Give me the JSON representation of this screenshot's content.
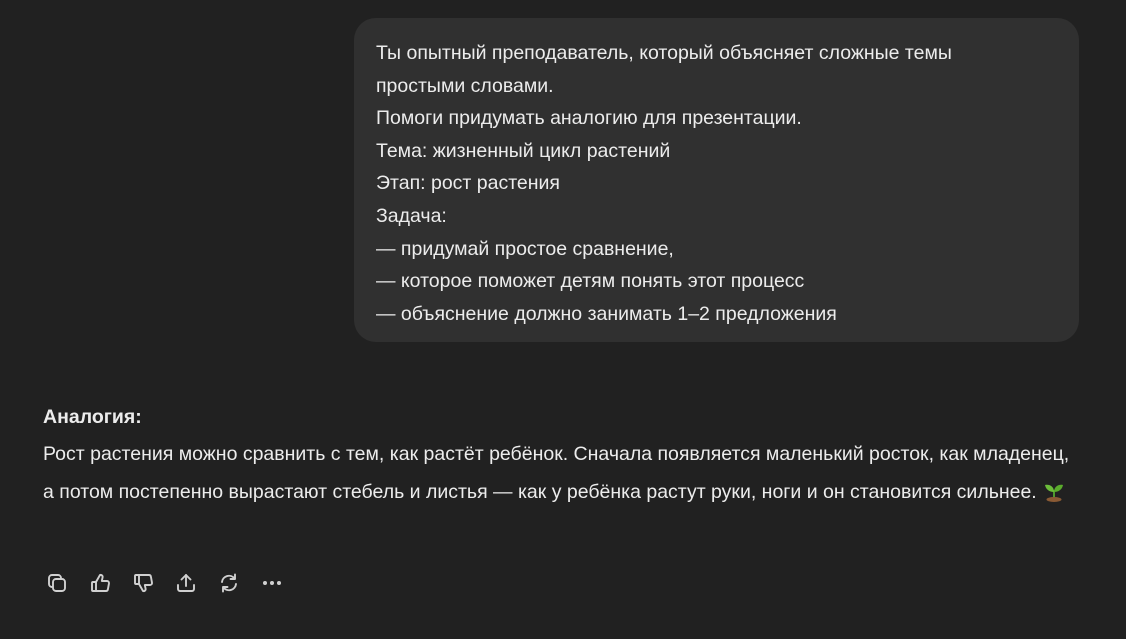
{
  "user_message": {
    "lines": [
      "Ты опытный преподаватель, который объясняет сложные темы",
      "простыми словами.",
      "Помоги придумать аналогию для презентации.",
      "Тема: жизненный цикл растений",
      "Этап: рост растения",
      "Задача:",
      "— придумай простое сравнение,",
      "— которое поможет детям понять этот процесс",
      "— объяснение должно занимать 1–2 предложения"
    ]
  },
  "assistant_message": {
    "heading": "Аналогия:",
    "body": "Рост растения можно сравнить с тем, как растёт ребёнок. Сначала появляется маленький росток, как младенец, а потом постепенно вырастают стебель и листья — как у ребёнка растут руки, ноги и он становится сильнее.",
    "emoji": "seedling-icon"
  },
  "actions": [
    {
      "icon": "copy-icon"
    },
    {
      "icon": "thumbs-up-icon"
    },
    {
      "icon": "thumbs-down-icon"
    },
    {
      "icon": "share-icon"
    },
    {
      "icon": "regenerate-icon"
    },
    {
      "icon": "more-icon"
    }
  ],
  "colors": {
    "background": "#212121",
    "bubble": "#303030",
    "text": "#ececec",
    "icon": "#d0d0d0"
  }
}
